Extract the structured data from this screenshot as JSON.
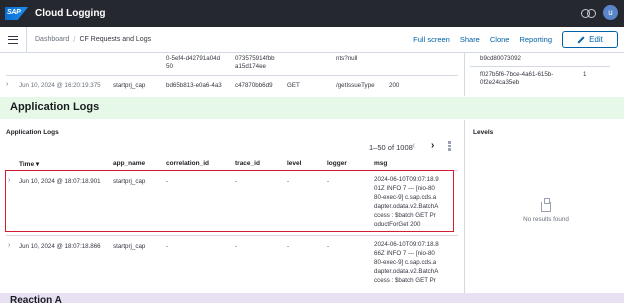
{
  "header": {
    "logo_text": "SAP",
    "title": "Cloud Logging",
    "avatar_initial": "u"
  },
  "nav": {
    "breadcrumb_dashboard": "Dashboard",
    "breadcrumb_current": "CF Requests and Logs",
    "links": [
      "Full screen",
      "Share",
      "Clone",
      "Reporting"
    ],
    "edit_label": "Edit"
  },
  "upper_rows": {
    "row1": {
      "correlation_id": [
        "0-5ef4-d42791a04d",
        "50"
      ],
      "trace_id": [
        "073575914fbb",
        "a15d174ee"
      ],
      "msg": [
        "nts?null"
      ]
    },
    "row2": {
      "time": "Jun 10, 2024 @ 16:20:19.375",
      "app_name": "startprj_cap",
      "correlation_id": "bd65b813-e0a6-4a3",
      "trace_id": "c47870bb6d9",
      "level": "GET",
      "logger": "/getIssueType",
      "msg": "200"
    },
    "right": {
      "line1": "b9cd80073092",
      "line2": "f027b5f6-7bce-4a61-615b-",
      "line3": "0f2e24ca35eb",
      "count": "1"
    }
  },
  "app_logs": {
    "band_title": "Application Logs",
    "panel_title": "Application Logs",
    "levels_title": "Levels",
    "pager_text": "1–50 of 1008",
    "columns": [
      "Time",
      "app_name",
      "correlation_id",
      "trace_id",
      "level",
      "logger",
      "msg"
    ],
    "rows": [
      {
        "time": "Jun 10, 2024 @ 18:07:18.901",
        "app_name": "startprj_cap",
        "correlation_id": "-",
        "trace_id": "-",
        "level": "-",
        "logger": "-",
        "msg_lines": [
          "2024-06-10T09:07:18.9",
          "01Z  INFO 7 --- [nio-80",
          "80-exec-9] c.sap.cds.a",
          "dapter.odata.v2.BatchA",
          "ccess  : $batch GET Pr",
          "oductForGet 200"
        ]
      },
      {
        "time": "Jun 10, 2024 @ 18:07:18.866",
        "app_name": "startprj_cap",
        "correlation_id": "-",
        "trace_id": "-",
        "level": "-",
        "logger": "-",
        "msg_lines": [
          "2024-06-10T09:07:18.8",
          "66Z  INFO 7 --- [nio-80",
          "80-exec-9] c.sap.cds.a",
          "dapter.odata.v2.BatchA",
          "ccess  : $batch GET Pr"
        ]
      }
    ],
    "empty_text": "No results found"
  },
  "bottom_band_title": "Reaction A",
  "colors": {
    "header_bg": "#25282f",
    "link": "#0061a6",
    "band_green": "#e6f9e8",
    "selected_border": "#d11d2f",
    "band_purple": "#e8e0f3"
  }
}
